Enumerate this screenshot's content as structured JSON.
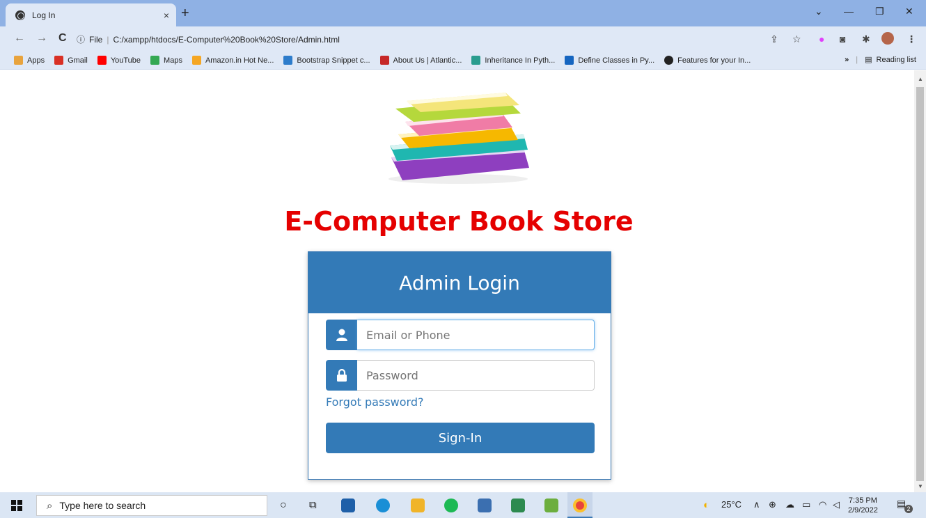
{
  "browser": {
    "tab_title": "Log In",
    "tab_close": "×",
    "new_tab": "+",
    "url_info": "File",
    "url": "C:/xampp/htdocs/E-Computer%20Book%20Store/Admin.html",
    "bookmarks": [
      {
        "label": "Apps",
        "color": "#e8a33d"
      },
      {
        "label": "Gmail",
        "color": "#d93025"
      },
      {
        "label": "YouTube",
        "color": "#ff0000"
      },
      {
        "label": "Maps",
        "color": "#34a853"
      },
      {
        "label": "Amazon.in Hot Ne...",
        "color": "#f5a623"
      },
      {
        "label": "Bootstrap Snippet c...",
        "color": "#2d7ccb"
      },
      {
        "label": "About Us | Atlantic...",
        "color": "#c62828"
      },
      {
        "label": "Inheritance In Pyth...",
        "color": "#2a9d8f"
      },
      {
        "label": "Define Classes in Py...",
        "color": "#1565c0"
      },
      {
        "label": "Features for your In...",
        "color": "#222222"
      }
    ],
    "more": "»",
    "reading_list": "Reading list"
  },
  "page": {
    "store_title": "E-Computer Book Store",
    "login_title": "Admin Login",
    "email_placeholder": "Email or Phone",
    "password_placeholder": "Password",
    "forgot": "Forgot password?",
    "signin": "Sign-In"
  },
  "taskbar": {
    "search_placeholder": "Type here to search",
    "weather": "25°C",
    "time": "7:35 PM",
    "date": "2/9/2022",
    "notif_count": "2"
  }
}
